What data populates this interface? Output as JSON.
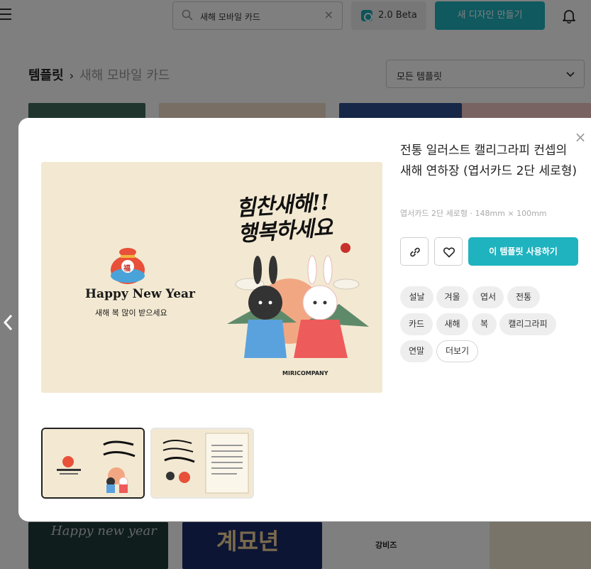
{
  "topbar": {
    "search_value": "새해 모바일 카드",
    "beta_label": "2.0 Beta",
    "new_design_label": "새 디자인 만들기"
  },
  "breadcrumb": {
    "root": "템플릿",
    "separator": "›",
    "current": "새해 모바일 카드"
  },
  "filter": {
    "selected": "모든 템플릿"
  },
  "background_tiles": {
    "tile_7_text": "계묘년",
    "tile_8_text": "강비즈"
  },
  "modal": {
    "title": "전통 일러스트 캘리그라피 컨셉의 새해 연하장 (엽서카드 2단 세로형)",
    "spec": "엽서카드 2단 세로형 · 148mm × 100mm",
    "use_button_label": "이 템플릿 사용하기",
    "preview": {
      "happy_new_year": "Happy New Year",
      "subtitle": "새해 복 많이 받으세요",
      "calligraphy_line1": "힘찬새해!!",
      "calligraphy_line2": "행복하세요",
      "brand": "MIRICOMPANY",
      "pouch_char": "福"
    },
    "tags": [
      "설날",
      "겨울",
      "엽서",
      "전통",
      "카드",
      "새해",
      "복",
      "캘리그라피",
      "연말",
      "더보기"
    ],
    "colors": {
      "accent": "#1fb3bf",
      "card_bg": "#f3e9d2"
    }
  }
}
